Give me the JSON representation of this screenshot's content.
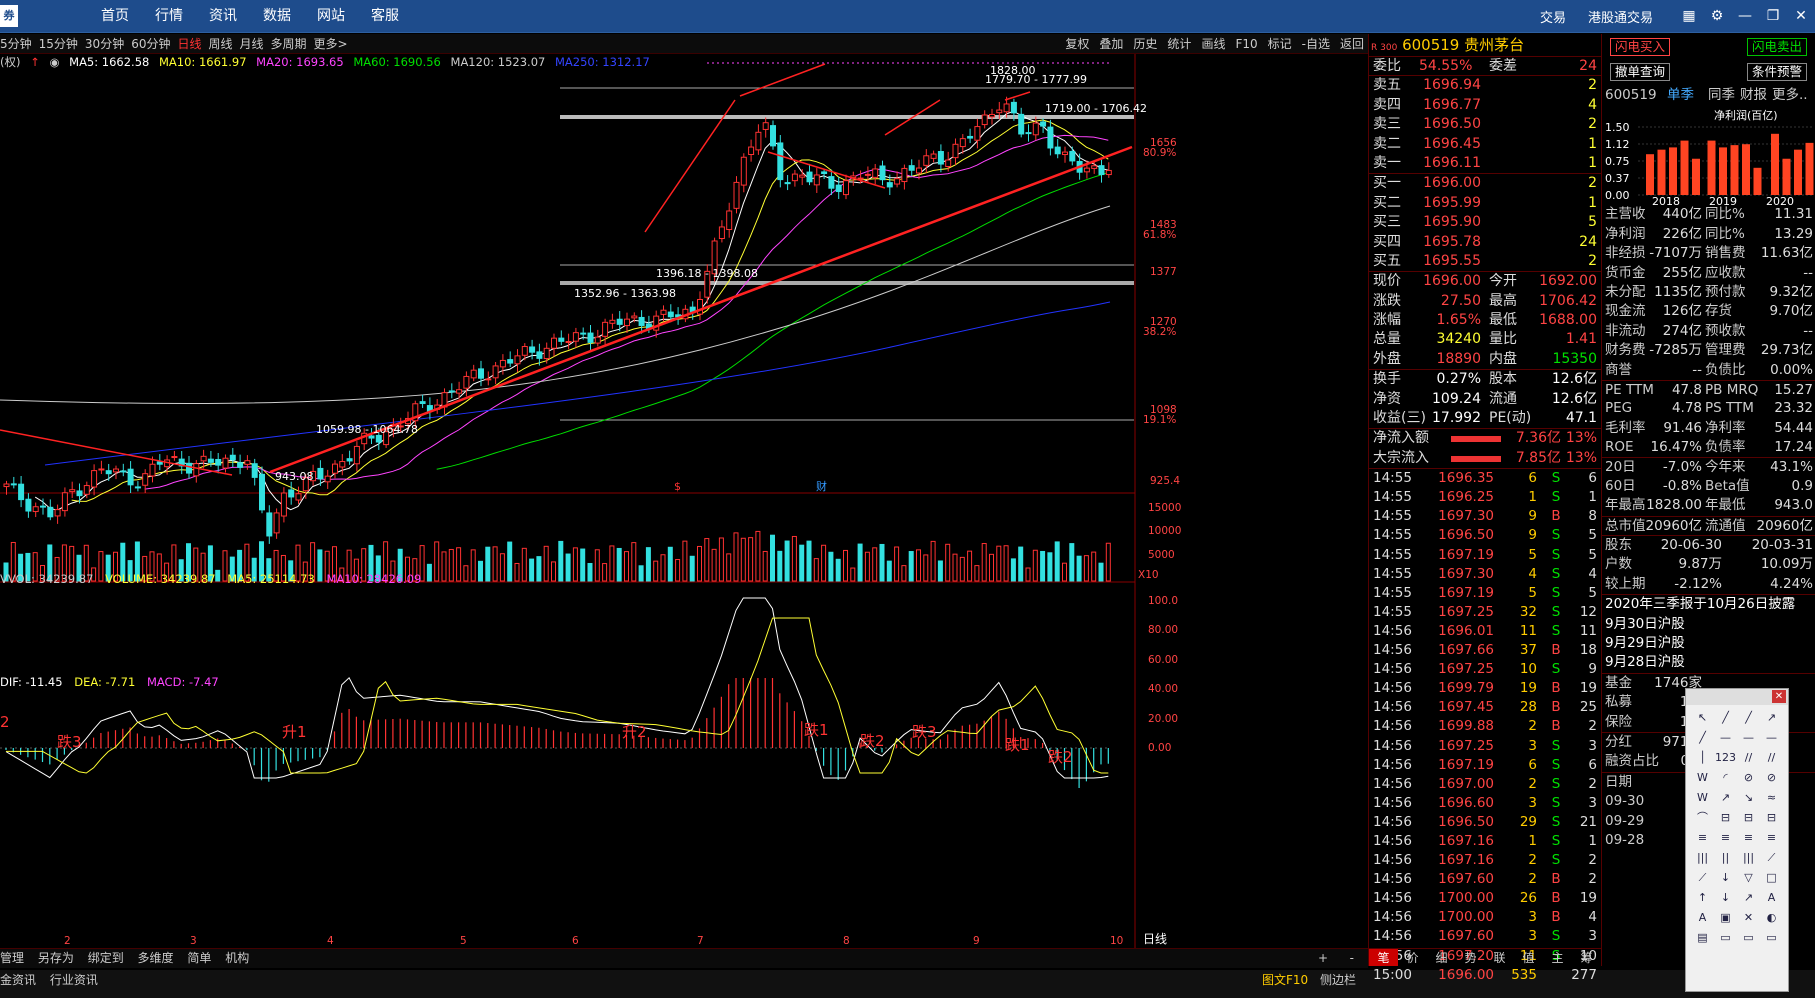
{
  "topnav": {
    "logo": "券",
    "items": [
      "首页",
      "行情",
      "资讯",
      "数据",
      "网站",
      "客服"
    ],
    "right": [
      "交易",
      "港股通交易"
    ]
  },
  "periods": [
    "5分钟",
    "15分钟",
    "30分钟",
    "60分钟",
    "日线",
    "周线",
    "月线",
    "多周期",
    "更多>"
  ],
  "tools": [
    "复权",
    "叠加",
    "历史",
    "统计",
    "画线",
    "F10",
    "标记",
    "-自选",
    "返回"
  ],
  "ma": {
    "prefix": "(权)",
    "ma5": "MA5: 1662.58",
    "ma10": "MA10: 1661.97",
    "ma20": "MA20: 1693.65",
    "ma60": "MA60: 1690.56",
    "ma120": "MA120: 1523.07",
    "ma250": "MA250: 1312.17"
  },
  "vol": {
    "vvol": "VVOL: 34239.87",
    "volume": "VOLUME: 34239.87",
    "ma5": "MA5: 25114.73",
    "ma10": "MA10: 28426.09"
  },
  "macd": {
    "dif": "DIF: -11.45",
    "dea": "DEA: -7.71",
    "macd": "MACD: -7.47"
  },
  "price_axis": [
    {
      "label": "1656",
      "sub": "80.9%"
    },
    {
      "label": "1483",
      "sub": "61.8%"
    },
    {
      "label": "1377",
      "sub": ""
    },
    {
      "label": "1270",
      "sub": "38.2%"
    },
    {
      "label": "1098",
      "sub": "19.1%"
    },
    {
      "label": "925.4",
      "sub": ""
    }
  ],
  "vol_axis": [
    "15000",
    "10000",
    "5000"
  ],
  "vol_unit": "X10",
  "macd_axis": [
    "100.0",
    "80.00",
    "60.00",
    "40.00",
    "20.00",
    "0.00"
  ],
  "month_axis": [
    "2",
    "3",
    "4",
    "5",
    "6",
    "7",
    "8",
    "9",
    "10"
  ],
  "annotations": {
    "high": "1828.00",
    "h2": "1779.70 - 1777.99",
    "h3": "1719.00 - 1706.42",
    "g1": "1396.18 - 1398.08",
    "g2": "1352.96 - 1363.98",
    "g3": "1059.98 - 1064.78",
    "low": "943.08",
    "s": "$",
    "cai": "财"
  },
  "macd_labels": [
    "2",
    "跌3",
    "升1",
    "升2",
    "跌1",
    "跌2",
    "跌3",
    "跌1",
    "跌2"
  ],
  "bottom_tabs": [
    "管理",
    "另存为",
    "绑定到",
    "多维度",
    "简单",
    "机构"
  ],
  "bottom_right": [
    "+",
    "-"
  ],
  "status": [
    "金资讯",
    "行业资讯"
  ],
  "status_right": [
    "图文F10",
    "侧边栏"
  ],
  "daily_label": "日线",
  "stock": {
    "code": "600519",
    "name": "贵州茅台",
    "tag": "R 300"
  },
  "weibi": {
    "l": "委比",
    "v": "54.55%",
    "l2": "委差",
    "v2": "24"
  },
  "sells": [
    {
      "l": "卖五",
      "p": "1696.94",
      "q": "2"
    },
    {
      "l": "卖四",
      "p": "1696.77",
      "q": "4"
    },
    {
      "l": "卖三",
      "p": "1696.50",
      "q": "2"
    },
    {
      "l": "卖二",
      "p": "1696.45",
      "q": "1"
    },
    {
      "l": "卖一",
      "p": "1696.11",
      "q": "1"
    }
  ],
  "buys": [
    {
      "l": "买一",
      "p": "1696.00",
      "q": "2"
    },
    {
      "l": "买二",
      "p": "1695.99",
      "q": "1"
    },
    {
      "l": "买三",
      "p": "1695.90",
      "q": "5"
    },
    {
      "l": "买四",
      "p": "1695.78",
      "q": "24"
    },
    {
      "l": "买五",
      "p": "1695.55",
      "q": "2"
    }
  ],
  "quote": [
    {
      "l1": "现价",
      "v1": "1696.00",
      "l2": "今开",
      "v2": "1692.00",
      "c1": "red",
      "c2": "red"
    },
    {
      "l1": "涨跌",
      "v1": "27.50",
      "l2": "最高",
      "v2": "1706.42",
      "c1": "red",
      "c2": "red"
    },
    {
      "l1": "涨幅",
      "v1": "1.65%",
      "l2": "最低",
      "v2": "1688.00",
      "c1": "red",
      "c2": "red"
    },
    {
      "l1": "总量",
      "v1": "34240",
      "l2": "量比",
      "v2": "1.41",
      "c1": "yel",
      "c2": "red"
    },
    {
      "l1": "外盘",
      "v1": "18890",
      "l2": "内盘",
      "v2": "15350",
      "c1": "red",
      "c2": "green"
    }
  ],
  "quote2": [
    {
      "l1": "换手",
      "v1": "0.27%",
      "l2": "股本",
      "v2": "12.6亿"
    },
    {
      "l1": "净资",
      "v1": "109.24",
      "l2": "流通",
      "v2": "12.6亿"
    },
    {
      "l1": "收益(三)",
      "v1": "17.992",
      "l2": "PE(动)",
      "v2": "47.1"
    }
  ],
  "flow": [
    {
      "l": "净流入额",
      "v": "7.36亿",
      "p": "13%"
    },
    {
      "l": "大宗流入",
      "v": "7.85亿",
      "p": "13%"
    }
  ],
  "ticks": [
    [
      "14:55",
      "1696.35",
      "6",
      "S",
      "6"
    ],
    [
      "14:55",
      "1696.25",
      "1",
      "S",
      "1"
    ],
    [
      "14:55",
      "1697.30",
      "9",
      "B",
      "8"
    ],
    [
      "14:55",
      "1696.50",
      "9",
      "S",
      "5"
    ],
    [
      "14:55",
      "1697.19",
      "5",
      "S",
      "5"
    ],
    [
      "14:55",
      "1697.30",
      "4",
      "S",
      "4"
    ],
    [
      "14:55",
      "1697.19",
      "5",
      "S",
      "5"
    ],
    [
      "14:55",
      "1697.25",
      "32",
      "S",
      "12"
    ],
    [
      "14:56",
      "1696.01",
      "11",
      "S",
      "11"
    ],
    [
      "14:56",
      "1697.66",
      "37",
      "B",
      "18"
    ],
    [
      "14:56",
      "1697.25",
      "10",
      "S",
      "9"
    ],
    [
      "14:56",
      "1699.79",
      "19",
      "B",
      "19"
    ],
    [
      "14:56",
      "1697.45",
      "28",
      "B",
      "25"
    ],
    [
      "14:56",
      "1699.88",
      "2",
      "B",
      "2"
    ],
    [
      "14:56",
      "1697.25",
      "3",
      "S",
      "3"
    ],
    [
      "14:56",
      "1697.19",
      "6",
      "S",
      "6"
    ],
    [
      "14:56",
      "1697.00",
      "2",
      "S",
      "2"
    ],
    [
      "14:56",
      "1696.60",
      "3",
      "S",
      "3"
    ],
    [
      "14:56",
      "1696.50",
      "29",
      "S",
      "21"
    ],
    [
      "14:56",
      "1697.16",
      "1",
      "S",
      "1"
    ],
    [
      "14:56",
      "1697.16",
      "2",
      "S",
      "2"
    ],
    [
      "14:56",
      "1697.60",
      "2",
      "B",
      "2"
    ],
    [
      "14:56",
      "1700.00",
      "26",
      "B",
      "19"
    ],
    [
      "14:56",
      "1700.00",
      "3",
      "B",
      "4"
    ],
    [
      "14:56",
      "1697.60",
      "3",
      "S",
      "3"
    ],
    [
      "14:56",
      "1697.20",
      "11",
      "S",
      "10"
    ],
    [
      "15:00",
      "1696.00",
      "535",
      "",
      "277"
    ]
  ],
  "bottom_tabs2": [
    "笔",
    "价",
    "细",
    "势",
    "联",
    "值",
    "主",
    "筹"
  ],
  "rp2": {
    "btn1": "闪电买入",
    "btn2": "闪电卖出",
    "btn3": "撤单查询",
    "btn4": "条件预警",
    "code": "600519",
    "tabs": [
      "单季",
      "同季",
      "财报",
      "更多.."
    ],
    "unit": "净利润(百亿)",
    "yaxis": [
      "1.50",
      "1.12",
      "0.75",
      "0.37",
      "0.00"
    ],
    "years": [
      "2018",
      "2019",
      "2020"
    ]
  },
  "fin_chart": {
    "type": "bar",
    "ylim": [
      0,
      1.5
    ],
    "values": [
      0.9,
      1.0,
      1.05,
      1.2,
      0.8,
      1.2,
      1.05,
      1.1,
      1.12,
      0.6,
      1.35,
      0.8,
      1.0,
      1.15
    ]
  },
  "fin": [
    [
      "主营收",
      "440亿",
      "同比%",
      "11.31"
    ],
    [
      "净利润",
      "226亿",
      "同比%",
      "13.29"
    ],
    [
      "非经损",
      "-7107万",
      "销售费",
      "11.63亿"
    ],
    [
      "货币金",
      "255亿",
      "应收款",
      "--"
    ],
    [
      "未分配",
      "1135亿",
      "预付款",
      "9.32亿"
    ],
    [
      "现金流",
      "126亿",
      "存货",
      "9.70亿"
    ],
    [
      "非流动",
      "274亿",
      "预收款",
      "--"
    ],
    [
      "财务费",
      "-7285万",
      "管理费",
      "29.73亿"
    ],
    [
      "商誉",
      "--",
      "负债比",
      "0.00%"
    ],
    [
      "PE TTM",
      "47.8",
      "PB MRQ",
      "15.27"
    ],
    [
      "PEG",
      "4.78",
      "PS TTM",
      "23.32"
    ],
    [
      "毛利率",
      "91.46",
      "净利率",
      "54.44"
    ],
    [
      "ROE",
      "16.47%",
      "负债率",
      "17.24"
    ],
    [
      "20日",
      "-7.0%",
      "今年来",
      "43.1%"
    ],
    [
      "60日",
      "-0.8%",
      "Beta值",
      "0.9"
    ],
    [
      "年最高",
      "1828.00",
      "年最低",
      "943.0"
    ],
    [
      "总市值",
      "20960亿",
      "流通值",
      "20960亿"
    ]
  ],
  "holders": {
    "label": "股东",
    "d1": "20-06-30",
    "d2": "20-03-31",
    "rows": [
      [
        "户数",
        "9.87万",
        "10.09万"
      ],
      [
        "较上期",
        "-2.12%",
        "4.24%"
      ]
    ]
  },
  "news": [
    "2020年三季报于10月26日披露",
    "9月30日沪股",
    "9月29日沪股",
    "9月28日沪股"
  ],
  "inst": [
    [
      "基金",
      "1746家"
    ],
    [
      "私募",
      "1家"
    ],
    [
      "保险",
      "1家"
    ]
  ],
  "misc": [
    [
      "分红",
      "971亿"
    ],
    [
      "融资占比",
      "0.8"
    ]
  ],
  "dates": {
    "label": "日期",
    "rows": [
      "09-30",
      "09-29",
      "09-28"
    ]
  },
  "tool_window": [
    "↖",
    "╱",
    "╱",
    "↗",
    "╱",
    "—",
    "—",
    "—",
    "│",
    "123",
    "//",
    "//",
    "W",
    "◜",
    "⊘",
    "⊘",
    "W",
    "↗",
    "↘",
    "≈",
    "⌒",
    "⊟",
    "⊟",
    "⊟",
    "≡",
    "≡",
    "≡",
    "≡",
    "|||",
    "||",
    "|||",
    "⟋",
    "⟋",
    "↓",
    "▽",
    "□",
    "↑",
    "↓",
    "↗",
    "A",
    "A",
    "▣",
    "✕",
    "◐",
    "▤",
    "▭",
    "▭",
    "▭"
  ]
}
